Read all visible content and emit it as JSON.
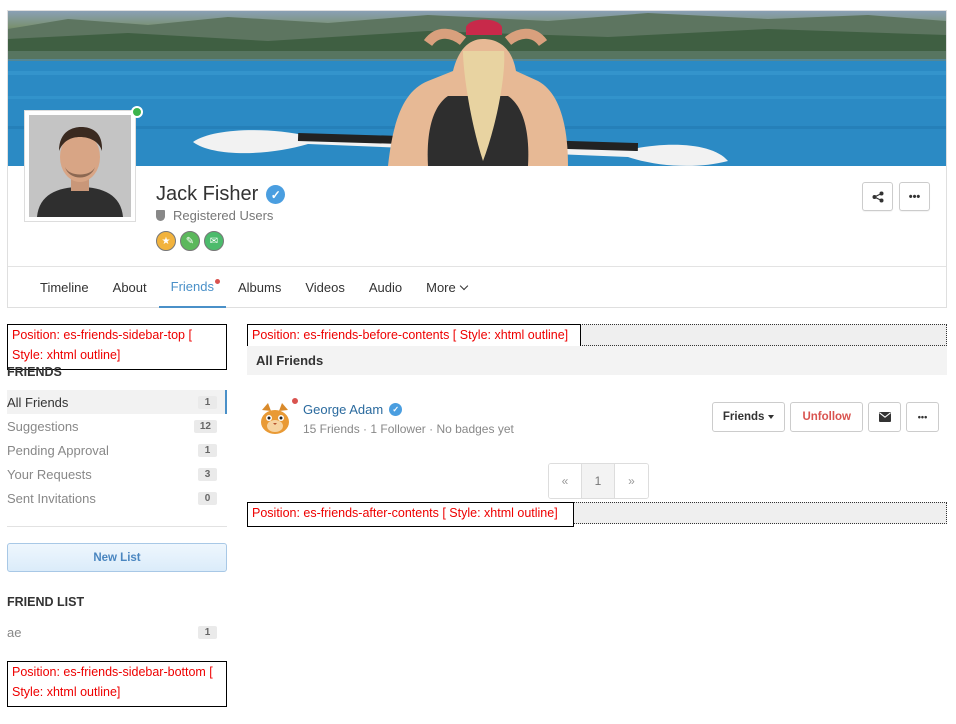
{
  "profile": {
    "name": "Jack Fisher",
    "group": "Registered Users",
    "online": true,
    "verified": true,
    "badge_colors": [
      "#f2b33d",
      "#5cb85c",
      "#4cbb6c"
    ],
    "accent_color": "#4a90c8"
  },
  "header_actions": {
    "share_icon": "share-icon",
    "more_icon": "ellipsis-icon"
  },
  "tabs": [
    {
      "label": "Timeline",
      "active": false
    },
    {
      "label": "About",
      "active": false
    },
    {
      "label": "Friends",
      "active": true,
      "has_notification": true
    },
    {
      "label": "Albums",
      "active": false
    },
    {
      "label": "Videos",
      "active": false
    },
    {
      "label": "Audio",
      "active": false
    },
    {
      "label": "More",
      "active": false,
      "dropdown": true
    }
  ],
  "modules": {
    "sidebar_top": "Position: es-friends-sidebar-top [ Style: xhtml outline]",
    "before_contents": "Position: es-friends-before-contents [ Style: xhtml outline]",
    "after_contents": "Position: es-friends-after-contents [ Style: xhtml outline]",
    "sidebar_bottom": "Position: es-friends-sidebar-bottom [ Style: xhtml outline]"
  },
  "sidebar": {
    "friends_heading": "FRIENDS",
    "items": [
      {
        "label": "All Friends",
        "count": "1",
        "active": true
      },
      {
        "label": "Suggestions",
        "count": "12",
        "active": false
      },
      {
        "label": "Pending Approval",
        "count": "1",
        "active": false
      },
      {
        "label": "Your Requests",
        "count": "3",
        "active": false
      },
      {
        "label": "Sent Invitations",
        "count": "0",
        "active": false
      }
    ],
    "new_list_label": "New List",
    "friend_list_heading": "FRIEND LIST",
    "lists": [
      {
        "label": "ae",
        "count": "1"
      }
    ]
  },
  "main": {
    "section_title": "All Friends",
    "friends": [
      {
        "name": "George Adam",
        "verified": true,
        "online": true,
        "friends": "15 Friends",
        "followers": "1 Follower",
        "badges": "No badges yet",
        "separator": "·",
        "actions": {
          "friends_label": "Friends",
          "unfollow_label": "Unfollow",
          "message_icon": "envelope-icon",
          "more_icon": "ellipsis-icon"
        }
      }
    ],
    "pagination": {
      "prev": "«",
      "current": "1",
      "next": "»"
    }
  }
}
